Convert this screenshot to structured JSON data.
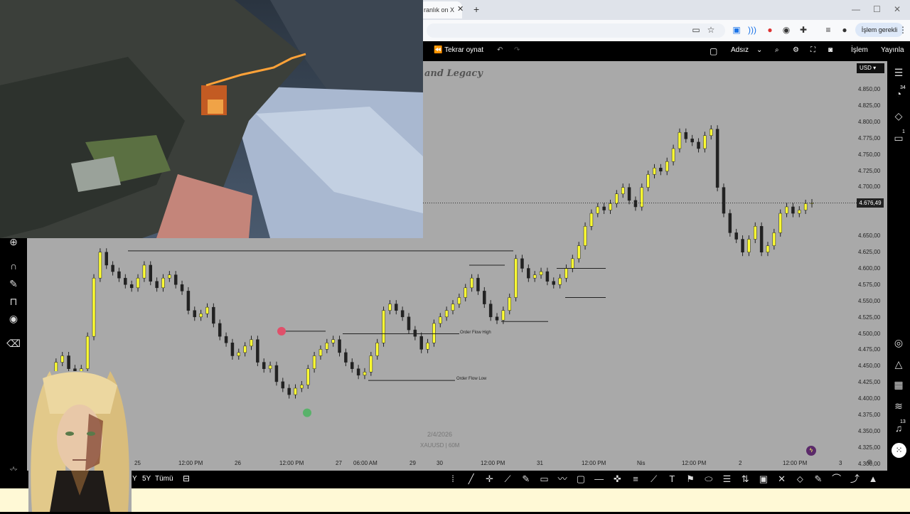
{
  "browser": {
    "tab_title": "ranlık on X",
    "tab_close": "✕",
    "new_tab": "+",
    "window_controls": [
      "—",
      "☐",
      "✕"
    ],
    "toolbar_icons": [
      "clipboard-icon",
      "star-icon",
      "cast-icon",
      "wifi-icon",
      "extension-red-icon",
      "extension-mask-icon",
      "puzzle-icon",
      "media-icon",
      "profile-icon"
    ],
    "islem_button": "İşlem gerekli",
    "menu": "⋮"
  },
  "tv_header": {
    "replay": "Tekrar oynat",
    "layout_name": "Adsız",
    "trade": "İşlem",
    "publish": "Yayınla"
  },
  "chart": {
    "watermark_text": "and Legacy",
    "currency": "USD",
    "current_price": "4.676,49",
    "center_date": "2/4/2026",
    "symbol_info": "XAUUSD | 60M",
    "price_labels": [
      "4.850,00",
      "4.825,00",
      "4.800,00",
      "4.775,00",
      "4.750,00",
      "4.725,00",
      "4.700,00",
      "4.650,00",
      "4.625,00",
      "4.600,00",
      "4.575,00",
      "4.550,00",
      "4.525,00",
      "4.500,00",
      "4.475,00",
      "4.450,00",
      "4.425,00",
      "4.400,00",
      "4.375,00",
      "4.350,00",
      "4.325,00",
      "4.300,00"
    ],
    "time_labels": [
      "25",
      "12:00 PM",
      "26",
      "12:00 PM",
      "27",
      "06:00 AM",
      "29",
      "30",
      "12:00 PM",
      "31",
      "12:00 PM",
      "Nis",
      "12:00 PM",
      "2",
      "12:00 PM",
      "3"
    ],
    "annotations": {
      "order_flow_high": "Order Flow High",
      "order_flow_low": "Order Flow Low"
    }
  },
  "chart_data": {
    "type": "candlestick",
    "title": "",
    "symbol": "XAUUSD",
    "interval": "60M",
    "ylim": [
      4290,
      4870
    ],
    "ohlc_close_approx": [
      4410,
      4430,
      4440,
      4420,
      4400,
      4420,
      4470,
      4560,
      4600,
      4580,
      4570,
      4560,
      4550,
      4545,
      4560,
      4580,
      4555,
      4545,
      4560,
      4565,
      4550,
      4540,
      4510,
      4500,
      4505,
      4515,
      4490,
      4470,
      4460,
      4440,
      4445,
      4455,
      4465,
      4430,
      4420,
      4425,
      4400,
      4390,
      4380,
      4390,
      4395,
      4420,
      4440,
      4450,
      4460,
      4465,
      4445,
      4430,
      4420,
      4410,
      4415,
      4440,
      4460,
      4510,
      4520,
      4510,
      4500,
      4480,
      4470,
      4450,
      4460,
      4490,
      4500,
      4510,
      4520,
      4530,
      4545,
      4560,
      4540,
      4520,
      4500,
      4495,
      4510,
      4530,
      4590,
      4575,
      4560,
      4565,
      4570,
      4555,
      4550,
      4560,
      4575,
      4590,
      4610,
      4640,
      4660,
      4670,
      4665,
      4675,
      4690,
      4700,
      4680,
      4670,
      4700,
      4720,
      4730,
      4725,
      4740,
      4760,
      4785,
      4775,
      4770,
      4760,
      4780,
      4790,
      4700,
      4660,
      4630,
      4620,
      4600,
      4620,
      4640,
      4600,
      4610,
      4630,
      4660,
      4670,
      4660,
      4665,
      4675,
      4676
    ]
  },
  "tv_left_tools": [
    "magnifier-plus-icon",
    "magnet-icon",
    "pencil-lock-icon",
    "lock-icon",
    "eye-icon",
    "trash-icon",
    "star-icon"
  ],
  "tv_right_tools": [
    "watchlist-icon",
    "alerts-icon",
    "layers-icon",
    "chat-icon",
    "target-icon",
    "up-icon",
    "calendar-icon",
    "feed-icon",
    "bell-icon",
    "grid-icon"
  ],
  "right_badges": {
    "alerts": "34",
    "chat": "1",
    "bell": "13"
  },
  "bottom_bar": {
    "range_1": "Y",
    "range_5y": "5Y",
    "range_all": "Tümü"
  }
}
